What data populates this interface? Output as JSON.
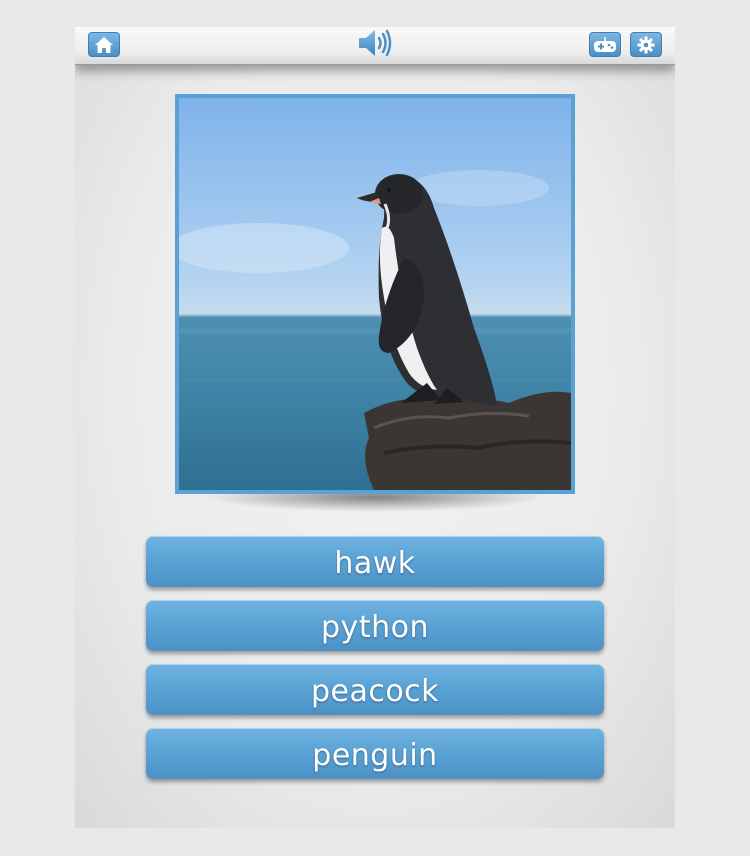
{
  "toolbar": {
    "home_icon": "home-icon",
    "sound_icon": "speaker-icon",
    "gamepad_icon": "gamepad-icon",
    "settings_icon": "gear-icon"
  },
  "quiz": {
    "image_subject": "penguin-photo",
    "answers": [
      {
        "label": "hawk"
      },
      {
        "label": "python"
      },
      {
        "label": "peacock"
      },
      {
        "label": "penguin"
      }
    ]
  },
  "colors": {
    "accent": "#5aa2d6",
    "button_text": "#ffffff",
    "background": "#ebebeb"
  }
}
